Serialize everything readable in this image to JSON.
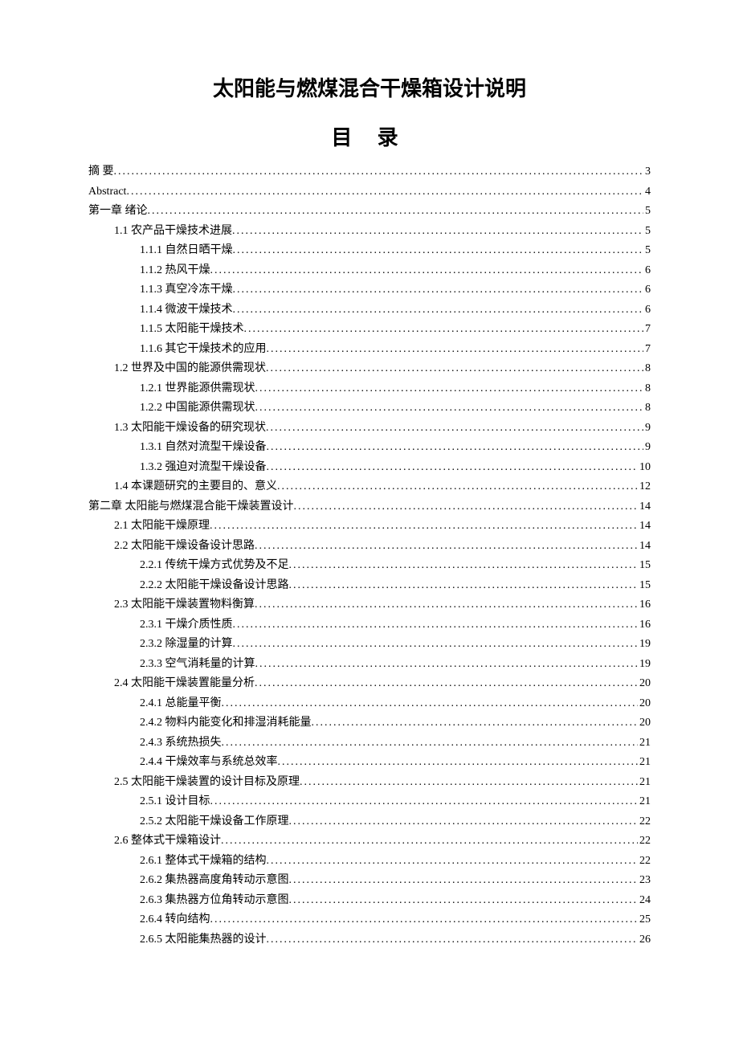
{
  "title": "太阳能与燃煤混合干燥箱设计说明",
  "toc_heading": "目  录",
  "entries": [
    {
      "level": 0,
      "label": "摘 要",
      "page": "3"
    },
    {
      "level": 0,
      "label": "Abstract",
      "page": "4"
    },
    {
      "level": 0,
      "label": "第一章  绪论",
      "page": "5"
    },
    {
      "level": 1,
      "label": "1.1 农产品干燥技术进展",
      "page": "5"
    },
    {
      "level": 2,
      "label": "1.1.1 自然日晒干燥",
      "page": "5"
    },
    {
      "level": 2,
      "label": "1.1.2 热风干燥",
      "page": "6"
    },
    {
      "level": 2,
      "label": "1.1.3 真空冷冻干燥",
      "page": "6"
    },
    {
      "level": 2,
      "label": "1.1.4 微波干燥技术",
      "page": "6"
    },
    {
      "level": 2,
      "label": "1.1.5 太阳能干燥技术",
      "page": "7"
    },
    {
      "level": 2,
      "label": "1.1.6 其它干燥技术的应用",
      "page": "7"
    },
    {
      "level": 1,
      "label": "1.2 世界及中国的能源供需现状",
      "page": "8"
    },
    {
      "level": 2,
      "label": "1.2.1 世界能源供需现状",
      "page": "8"
    },
    {
      "level": 2,
      "label": "1.2.2 中国能源供需现状",
      "page": "8"
    },
    {
      "level": 1,
      "label": "1.3 太阳能干燥设备的研究现状",
      "page": "9"
    },
    {
      "level": 2,
      "label": "1.3.1 自然对流型干燥设备",
      "page": "9"
    },
    {
      "level": 2,
      "label": "1.3.2 强迫对流型干燥设备",
      "page": "10"
    },
    {
      "level": 1,
      "label": "1.4 本课题研究的主要目的、意义",
      "page": "12"
    },
    {
      "level": 0,
      "label": "第二章  太阳能与燃煤混合能干燥装置设计",
      "page": "14"
    },
    {
      "level": 1,
      "label": "2.1 太阳能干燥原理",
      "page": "14"
    },
    {
      "level": 1,
      "label": "2.2 太阳能干燥设备设计思路",
      "page": "14"
    },
    {
      "level": 2,
      "label": "2.2.1 传统干燥方式优势及不足",
      "page": "15"
    },
    {
      "level": 2,
      "label": "2.2.2 太阳能干燥设备设计思路",
      "page": "15"
    },
    {
      "level": 1,
      "label": "2.3 太阳能干燥装置物料衡算",
      "page": "16"
    },
    {
      "level": 2,
      "label": "2.3.1 干燥介质性质",
      "page": "16"
    },
    {
      "level": 2,
      "label": "2.3.2  除湿量的计算",
      "page": "19"
    },
    {
      "level": 2,
      "label": "2.3.3  空气消耗量的计算",
      "page": "19"
    },
    {
      "level": 1,
      "label": "2.4 太阳能干燥装置能量分析",
      "page": "20"
    },
    {
      "level": 2,
      "label": "2.4.1  总能量平衡",
      "page": "20"
    },
    {
      "level": 2,
      "label": "2.4.2  物料内能变化和排湿消耗能量",
      "page": "20"
    },
    {
      "level": 2,
      "label": "2.4.3  系统热损失",
      "page": "21"
    },
    {
      "level": 2,
      "label": "2.4.4  干燥效率与系统总效率",
      "page": "21"
    },
    {
      "level": 1,
      "label": "2.5 太阳能干燥装置的设计目标及原理",
      "page": "21"
    },
    {
      "level": 2,
      "label": "2.5.1 设计目标",
      "page": "21"
    },
    {
      "level": 2,
      "label": "2.5.2 太阳能干燥设备工作原理",
      "page": "22"
    },
    {
      "level": 1,
      "label": "2.6 整体式干燥箱设计",
      "page": "22"
    },
    {
      "level": 2,
      "label": "2.6.1 整体式干燥箱的结构",
      "page": "22"
    },
    {
      "level": 2,
      "label": "2.6.2 集热器高度角转动示意图",
      "page": "23"
    },
    {
      "level": 2,
      "label": "2.6.3 集热器方位角转动示意图",
      "page": "24"
    },
    {
      "level": 2,
      "label": "2.6.4 转向结构",
      "page": "25"
    },
    {
      "level": 2,
      "label": "2.6.5 太阳能集热器的设计",
      "page": "26"
    }
  ]
}
